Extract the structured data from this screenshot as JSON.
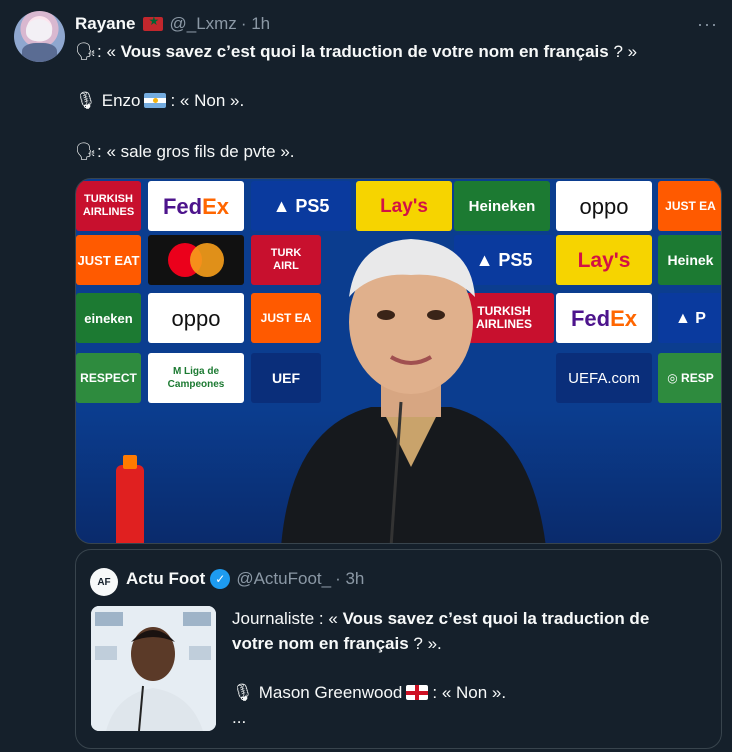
{
  "tweet": {
    "display_name": "Rayane",
    "handle": "@_Lxmz",
    "time": "· 1h",
    "more": "···",
    "line1_prefix": ": « ",
    "line1_bold": "Vous savez c’est quoi la traduction de votre nom en français",
    "line1_suffix": " ? »",
    "line2_name": "Enzo",
    "line2_suffix": ": « Non ».",
    "line3_text": ": « sale gros fils de pvte »."
  },
  "icons": {
    "speaking": "speaking-head-icon",
    "microphone": "studio-microphone-icon",
    "flag_morocco": "flag-morocco-icon",
    "flag_argentina": "flag-argentina-icon",
    "flag_england": "flag-england-icon",
    "verified": "verified-badge-icon"
  },
  "media": {
    "sponsors": [
      "TURKISH AIRLINES",
      "FedEx",
      "PS5",
      "Lay's",
      "Heineken",
      "oppo",
      "JUST EAT",
      "Liga de Campeones",
      "RESPECT",
      "UEFA.com"
    ]
  },
  "quote": {
    "avatar_text": "AF",
    "display_name": "Actu Foot",
    "handle": "@ActuFoot_",
    "time": "· 3h",
    "line1_prefix": "Journaliste : « ",
    "line1_bold": "Vous savez c’est quoi la traduction de",
    "line2_bold": "votre nom en français",
    "line2_suffix": " ? ».",
    "line3_name": "Mason Greenwood",
    "line3_suffix": ": « Non ».",
    "line4": "..."
  },
  "colors": {
    "background": "#15202b",
    "text": "#f7f9f9",
    "muted": "#8b98a5",
    "border": "#38444d",
    "verified": "#1d9bf0"
  }
}
